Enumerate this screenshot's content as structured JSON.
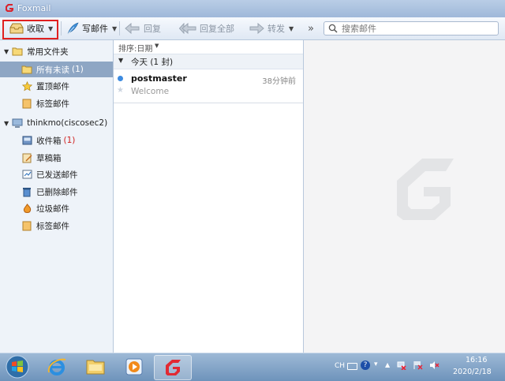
{
  "window": {
    "title": "Foxmail"
  },
  "toolbar": {
    "receive_label": "收取",
    "compose_label": "写邮件",
    "reply_label": "回复",
    "reply_all_label": "回复全部",
    "forward_label": "转发",
    "more_label": "»",
    "search_placeholder": "搜索邮件"
  },
  "sidebar": {
    "common_folders": {
      "label": "常用文件夹",
      "items": [
        {
          "label": "所有未读",
          "count": "(1)"
        },
        {
          "label": "置顶邮件"
        },
        {
          "label": "标签邮件"
        }
      ]
    },
    "account": {
      "label": "thinkmo(ciscosec2)",
      "items": [
        {
          "label": "收件箱",
          "count": "(1)"
        },
        {
          "label": "草稿箱"
        },
        {
          "label": "已发送邮件"
        },
        {
          "label": "已删除邮件"
        },
        {
          "label": "垃圾邮件"
        },
        {
          "label": "标签邮件"
        }
      ]
    }
  },
  "mail_list": {
    "sort_label": "排序:日期",
    "group_label": "今天 (1 封)",
    "messages": [
      {
        "sender": "postmaster",
        "time": "38分钟前",
        "subject": "Welcome"
      }
    ]
  },
  "taskbar": {
    "language": "CH",
    "time": "16:16",
    "date": "2020/2/18"
  },
  "colors": {
    "selection": "#8ea6c4",
    "highlight_box": "#e02020",
    "brand": "#d9232d"
  }
}
